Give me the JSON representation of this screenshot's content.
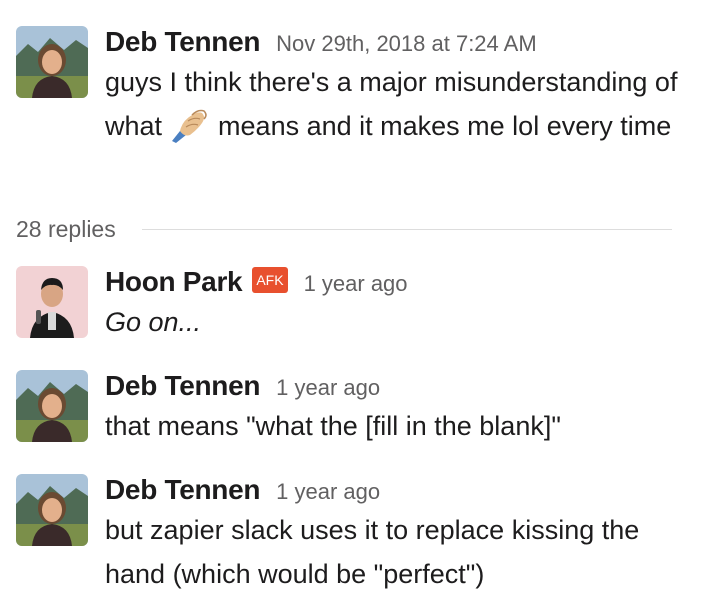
{
  "parent": {
    "author": "Deb Tennen",
    "timestamp": "Nov 29th, 2018 at 7:24 AM",
    "text_before_emoji": "guys I think there's a major misunderstanding of what",
    "emoji": "pinched-fingers-emoji",
    "text_after_emoji": "means and it makes me lol every time"
  },
  "thread": {
    "replies_label": "28 replies"
  },
  "replies": [
    {
      "author": "Hoon Park",
      "badge": "AFK",
      "timestamp": "1 year ago",
      "text": "Go on..."
    },
    {
      "author": "Deb Tennen",
      "timestamp": "1 year ago",
      "text": "that means \"what the [fill in the blank]\""
    },
    {
      "author": "Deb Tennen",
      "timestamp": "1 year ago",
      "text": "but zapier slack uses it to replace kissing the hand (which would be \"perfect\")"
    }
  ],
  "colors": {
    "afk_badge": "#e8502e",
    "meta_text": "#616061",
    "name_text": "#1d1c1d"
  }
}
